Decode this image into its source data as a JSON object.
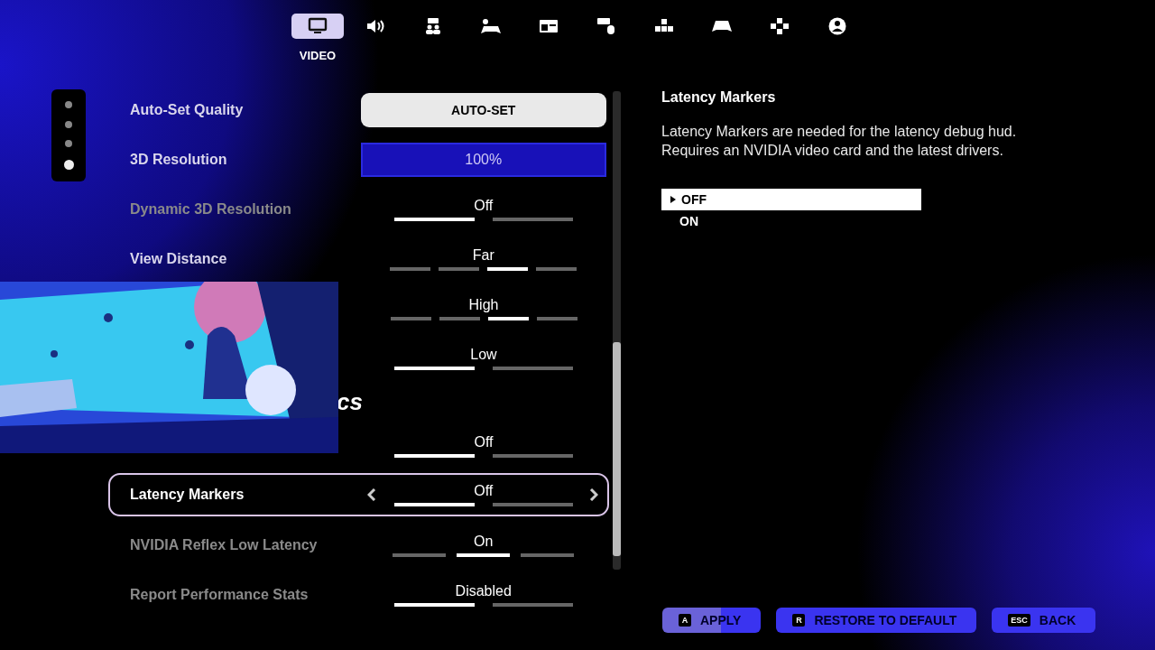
{
  "tabs": [
    {
      "label": "VIDEO",
      "selected": true
    },
    {
      "selected": false
    },
    {
      "selected": false
    },
    {
      "selected": false
    },
    {
      "selected": false
    },
    {
      "selected": false
    },
    {
      "selected": false
    },
    {
      "selected": false
    },
    {
      "selected": false
    },
    {
      "selected": false
    }
  ],
  "pager": [
    {
      "selected": false
    },
    {
      "selected": false
    },
    {
      "selected": false
    },
    {
      "selected": true
    }
  ],
  "settings": [
    {
      "kind": "button",
      "label": "Auto-Set Quality",
      "value": "AUTO-SET",
      "disabled": false,
      "selected": false
    },
    {
      "kind": "bar",
      "label": "3D Resolution",
      "value": "100%",
      "disabled": false,
      "selected": false
    },
    {
      "kind": "segments",
      "label": "Dynamic 3D Resolution",
      "value": "Off",
      "disabled": true,
      "selected": false,
      "segments": [
        {
          "selected": true
        },
        {
          "selected": false
        }
      ]
    },
    {
      "kind": "segments",
      "label": "View Distance",
      "value": "Far",
      "disabled": false,
      "selected": false,
      "segments": [
        {
          "selected": false
        },
        {
          "selected": false
        },
        {
          "selected": true
        },
        {
          "selected": false
        }
      ]
    },
    {
      "kind": "segments",
      "value": "High",
      "selected": false,
      "segments": [
        {
          "selected": false
        },
        {
          "selected": false
        },
        {
          "selected": true
        },
        {
          "selected": false
        }
      ]
    },
    {
      "kind": "segments",
      "value": "Low",
      "selected": false,
      "segments": [
        {
          "selected": true
        },
        {
          "selected": false
        }
      ]
    },
    {
      "kind": "heading",
      "label": "cs"
    },
    {
      "kind": "segments",
      "value": "Off",
      "selected": false,
      "segments": [
        {
          "selected": true
        },
        {
          "selected": false
        }
      ]
    },
    {
      "kind": "segments",
      "label": "Latency Markers",
      "value": "Off",
      "disabled": false,
      "selected": true,
      "segments": [
        {
          "selected": true
        },
        {
          "selected": false
        }
      ]
    },
    {
      "kind": "segments",
      "label": "NVIDIA Reflex Low Latency",
      "value": "On",
      "disabled": true,
      "selected": false,
      "segments": [
        {
          "selected": false
        },
        {
          "selected": true
        },
        {
          "selected": false
        }
      ]
    },
    {
      "kind": "segments",
      "label": "Report Performance Stats",
      "value": "Disabled",
      "disabled": true,
      "selected": false,
      "segments": [
        {
          "selected": true
        },
        {
          "selected": false
        }
      ]
    }
  ],
  "detail": {
    "title": "Latency Markers",
    "description": "Latency Markers are needed for the latency debug hud. Requires an NVIDIA video card and the latest drivers.",
    "options": [
      {
        "label": "OFF",
        "selected": true
      },
      {
        "label": "ON",
        "selected": false
      }
    ]
  },
  "footer": [
    {
      "key": "A",
      "label": "APPLY"
    },
    {
      "key": "R",
      "label": "RESTORE TO DEFAULT"
    },
    {
      "key": "ESC",
      "label": "BACK"
    }
  ]
}
